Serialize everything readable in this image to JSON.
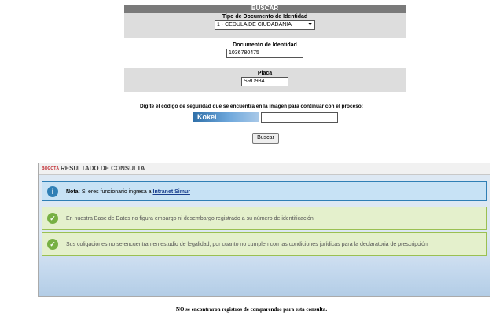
{
  "search": {
    "header": "BUSCAR",
    "doc_type_label": "Tipo de Documento de Identidad",
    "doc_type_value": "1 - CEDULA DE CIUDADANIA",
    "doc_number_label": "Documento de Identidad",
    "doc_number_value": "1036780475",
    "plate_label": "Placa",
    "plate_value": "SRD984",
    "captcha_label": "Digite el código de seguridad que se encuentra en la imagen para continuar con el proceso:",
    "captcha_text": "Kokel",
    "captcha_input_value": "",
    "button_label": "Buscar"
  },
  "result": {
    "logo_text": "BOGOTÁ",
    "title": "RESULTADO DE CONSULTA",
    "info_prefix": "Nota:",
    "info_text": " Si eres funcionario ingresa a ",
    "info_link": "Intranet Simur",
    "msg1": "En nuestra Base de Datos no figura embargo ni desembargo registrado a su número de identificación",
    "msg2": "Sus coligaciones no se encuentran en estudio de legalidad, por cuanto no cumplen con las condiciones jurídicas para la declaratoria de prescripción"
  },
  "footer_note": "NO se encontraron registros de comparendos para esta consulta.",
  "icons": {
    "info": "info-icon",
    "ok": "check-circle-icon",
    "dropdown": "chevron-down-icon"
  }
}
